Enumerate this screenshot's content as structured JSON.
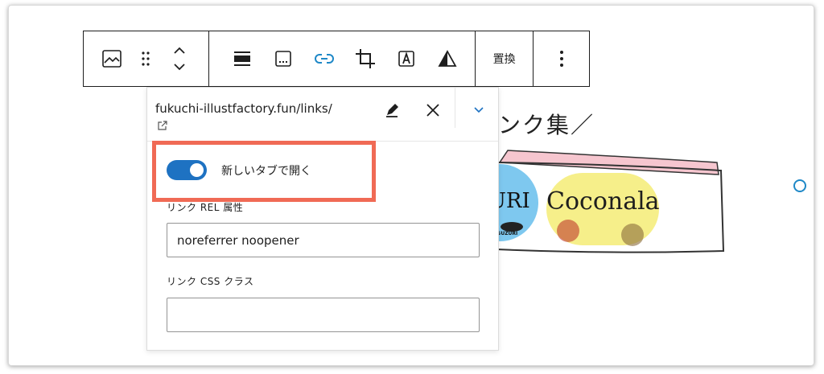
{
  "toolbar": {
    "replace_label": "置換"
  },
  "background": {
    "heading_text": "ンク集／",
    "logo1_text": "URI",
    "logo1_sub": "SUZURI",
    "logo2_text": "Coconala"
  },
  "link_popover": {
    "url": "fukuchi-illustfactory.fun/links/",
    "open_new_tab_label": "新しいタブで開く",
    "open_new_tab_enabled": true,
    "rel_label": "リンク REL 属性",
    "rel_value": "noreferrer noopener",
    "css_label": "リンク CSS クラス",
    "css_value": ""
  },
  "colors": {
    "accent": "#1e72c2",
    "highlight": "#f06a55",
    "link_icon": "#1e88c7"
  }
}
